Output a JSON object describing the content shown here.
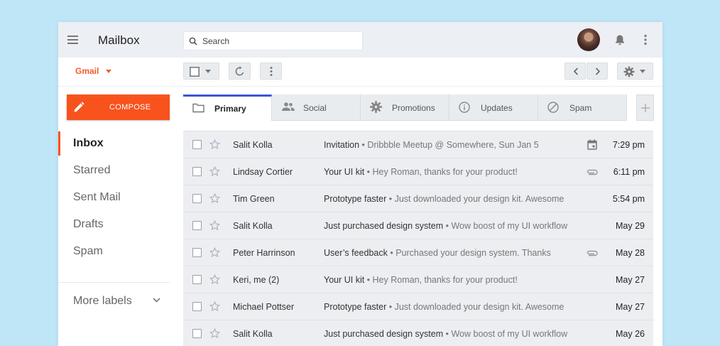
{
  "header": {
    "app_title": "Mailbox",
    "search_placeholder": "Search"
  },
  "toolbar": {
    "account_label": "Gmail"
  },
  "sidebar": {
    "compose_label": "COMPOSE",
    "items": [
      {
        "label": "Inbox",
        "active": true
      },
      {
        "label": "Starred"
      },
      {
        "label": "Sent Mail"
      },
      {
        "label": "Drafts"
      },
      {
        "label": "Spam"
      }
    ],
    "more_labels": "More labels"
  },
  "tabs": [
    {
      "label": "Primary",
      "icon": "folder-icon",
      "active": true
    },
    {
      "label": "Social",
      "icon": "people-icon"
    },
    {
      "label": "Promotions",
      "icon": "gear-badge-icon"
    },
    {
      "label": "Updates",
      "icon": "info-icon"
    },
    {
      "label": "Spam",
      "icon": "block-icon"
    }
  ],
  "emails": [
    {
      "sender": "Salit Kolla",
      "subject": "Invitation",
      "snippet": " • Dribbble Meetup @ Somewhere, Sun Jan 5",
      "time": "7:29 pm",
      "attachment": "calendar-icon"
    },
    {
      "sender": "Lindsay Cortier",
      "subject": "Your UI kit",
      "snippet": " • Hey Roman, thanks for your product!",
      "time": "6:11 pm",
      "attachment": "paperclip-icon"
    },
    {
      "sender": "Tim Green",
      "subject": "Prototype faster",
      "snippet": " • Just downloaded your design kit. Awesome",
      "time": "5:54 pm",
      "attachment": ""
    },
    {
      "sender": "Salit Kolla",
      "subject": "Just purchased design system",
      "snippet": " • Wow boost of my UI workflow",
      "time": "May 29",
      "attachment": ""
    },
    {
      "sender": "Peter Harrinson",
      "subject": "User’s feedback",
      "snippet": " • Purchased your design system. Thanks",
      "time": "May 28",
      "attachment": "paperclip-icon"
    },
    {
      "sender": "Keri, me (2)",
      "subject": "Your UI kit",
      "snippet": " • Hey Roman, thanks for your product!",
      "time": "May 27",
      "attachment": ""
    },
    {
      "sender": "Michael Pottser",
      "subject": "Prototype faster",
      "snippet": " • Just downloaded your design kit. Awesome",
      "time": "May 27",
      "attachment": ""
    },
    {
      "sender": "Salit Kolla",
      "subject": "Just purchased design system",
      "snippet": " • Wow boost of my UI workflow",
      "time": "May 26",
      "attachment": ""
    }
  ],
  "colors": {
    "accent": "#f8521d",
    "tab_active": "#3a56d4",
    "background": "#bfe6f7"
  }
}
